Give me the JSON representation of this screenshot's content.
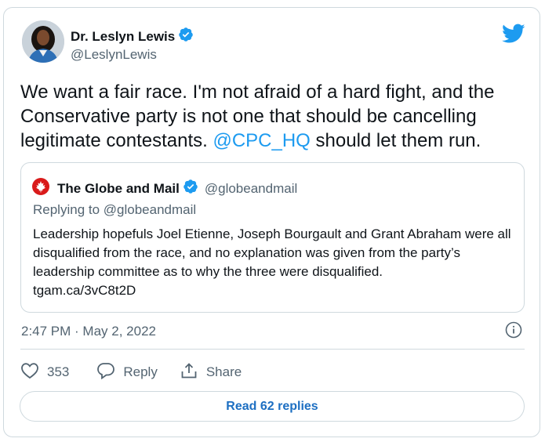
{
  "author": {
    "display_name": "Dr. Leslyn Lewis",
    "handle": "@LeslynLewis"
  },
  "tweet": {
    "text_before": "We want a fair race. I'm not afraid of a hard fight, and the Conservative party is not one that should be cancelling legitimate contestants. ",
    "mention": "@CPC_HQ",
    "text_after": " should let them run."
  },
  "quoted": {
    "display_name": "The Globe and Mail",
    "handle": "@globeandmail",
    "replying_to": "Replying to @globeandmail",
    "text": "Leadership hopefuls Joel Etienne, Joseph Bourgault and Grant Abraham were all disqualified from the race, and no explanation was given from the party’s leadership committee as to why the three were disqualified.",
    "link": "tgam.ca/3vC8t2D"
  },
  "meta": {
    "timestamp": "2:47 PM · May 2, 2022"
  },
  "actions": {
    "like_count": "353",
    "reply_label": "Reply",
    "share_label": "Share"
  },
  "replies_button": "Read 62 replies",
  "colors": {
    "accent": "#1d9bf0",
    "border": "#cfd9de",
    "muted": "#536471",
    "globe_red": "#d91a1a"
  },
  "icons": [
    "verified-badge-icon",
    "twitter-bird-icon",
    "maple-leaf-icon",
    "info-icon",
    "heart-icon",
    "reply-bubble-icon",
    "share-icon"
  ]
}
